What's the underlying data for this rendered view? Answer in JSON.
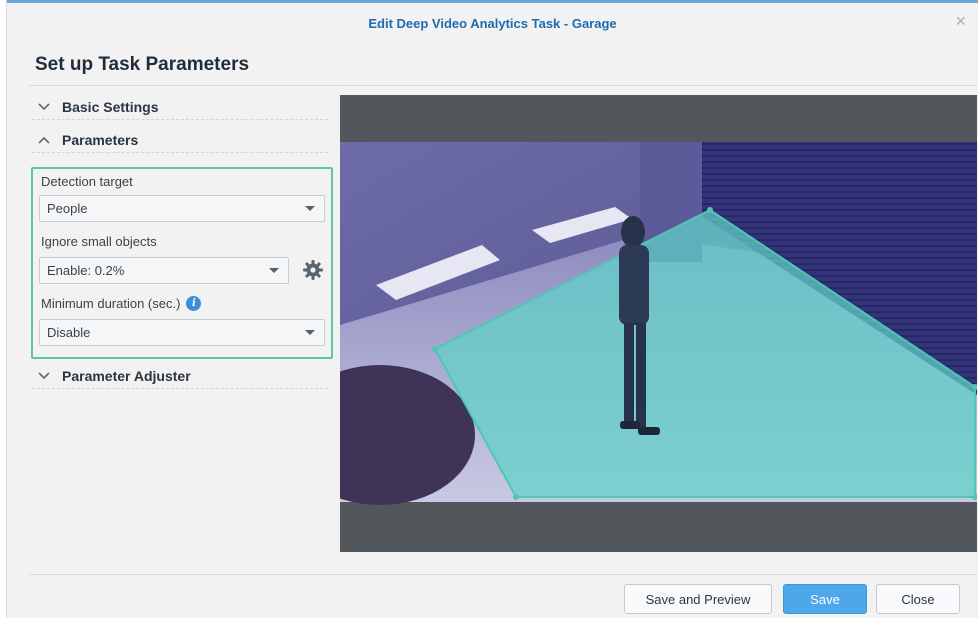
{
  "dialog": {
    "title": "Edit Deep Video Analytics Task - Garage",
    "close_glyph": "×"
  },
  "heading": "Set up Task Parameters",
  "sections": {
    "basic_settings": {
      "label": "Basic Settings",
      "expanded": false
    },
    "parameters": {
      "label": "Parameters",
      "expanded": true
    },
    "parameter_adjuster": {
      "label": "Parameter Adjuster",
      "expanded": false
    }
  },
  "parameters": {
    "detection_target": {
      "label": "Detection target",
      "value": "People"
    },
    "ignore_small_objects": {
      "label": "Ignore small objects",
      "value": "Enable: 0.2%"
    },
    "minimum_duration": {
      "label": "Minimum duration (sec.)",
      "value": "Disable"
    }
  },
  "icons": {
    "chevron_down": "chevron-down-icon",
    "chevron_up": "chevron-up-icon",
    "info": "info-icon",
    "settings": "gear-icon",
    "close": "close-icon"
  },
  "colors": {
    "title": "#1d6bb0",
    "panel_border": "#5fc79b",
    "detection_zone": "#5fd3c8",
    "primary_button": "#4da7e8"
  },
  "buttons": {
    "save_and_preview": "Save and Preview",
    "save": "Save",
    "close": "Close"
  }
}
